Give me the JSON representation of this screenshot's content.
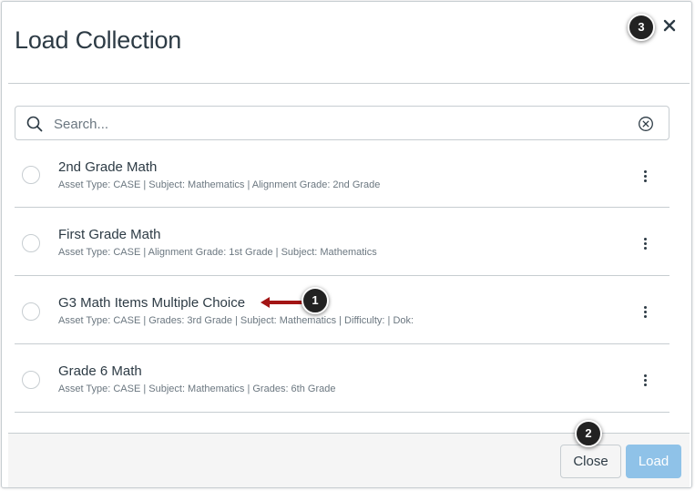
{
  "modal": {
    "title": "Load Collection",
    "close_icon": "close-icon"
  },
  "search": {
    "placeholder": "Search...",
    "search_icon": "search-icon",
    "clear_icon": "clear-circle-x-icon"
  },
  "collections": [
    {
      "name": "2nd Grade Math",
      "meta": "Asset Type: CASE | Subject: Mathematics | Alignment Grade: 2nd Grade"
    },
    {
      "name": "First Grade Math",
      "meta": "Asset Type: CASE | Alignment Grade: 1st Grade | Subject: Mathematics"
    },
    {
      "name": "G3 Math Items Multiple Choice",
      "meta": "Asset Type: CASE | Grades: 3rd Grade | Subject: Mathematics | Difficulty: | Dok:"
    },
    {
      "name": "Grade 6 Math",
      "meta": "Asset Type: CASE | Subject: Mathematics | Grades: 6th Grade"
    }
  ],
  "footer": {
    "close_label": "Close",
    "load_label": "Load"
  },
  "callouts": {
    "one": "1",
    "two": "2",
    "three": "3"
  },
  "colors": {
    "text": "#2d3b45",
    "muted": "#6b7780",
    "border": "#c7cdd1",
    "load_disabled": "#8fc2e8",
    "callout": "#222222",
    "arrow": "#a31515"
  }
}
